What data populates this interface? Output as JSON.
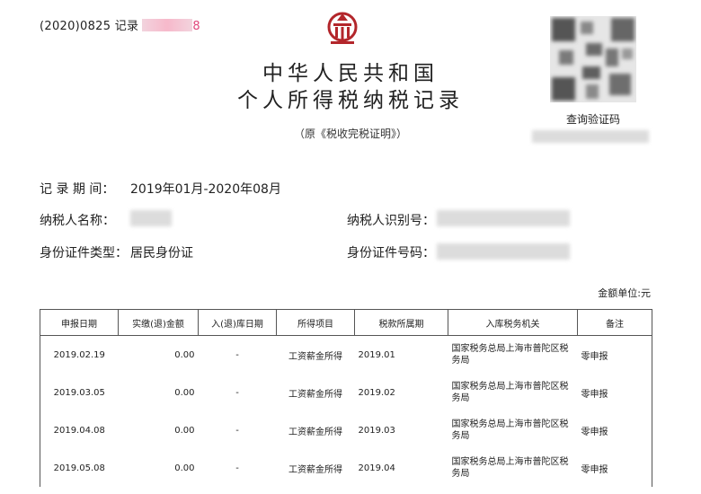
{
  "header": {
    "record_prefix": "(2020)0825  记录",
    "record_suffix": "8",
    "title_line1": "中华人民共和国",
    "title_line2": "个人所得税纳税记录",
    "subtitle": "（原《税收完税证明》）",
    "qr_label": "查询验证码"
  },
  "info": {
    "period_label": "记 录 期 间：",
    "period_value": "2019年01月-2020年08月",
    "name_label": "纳税人名称：",
    "taxid_label": "纳税人识别号：",
    "idtype_label": "身份证件类型：",
    "idtype_value": "居民身份证",
    "idno_label": "身份证件号码："
  },
  "table": {
    "unit": "金额单位:元",
    "headers": [
      "申报日期",
      "实缴(退)金额",
      "入(退)库日期",
      "所得项目",
      "税款所属期",
      "入库税务机关",
      "备注"
    ],
    "rows": [
      {
        "date": "2019.02.19",
        "amount": "0.00",
        "in_date": "-",
        "item": "工资薪金所得",
        "period": "2019.01",
        "authority": "国家税务总局上海市普陀区税务局",
        "note": "零申报"
      },
      {
        "date": "2019.03.05",
        "amount": "0.00",
        "in_date": "-",
        "item": "工资薪金所得",
        "period": "2019.02",
        "authority": "国家税务总局上海市普陀区税务局",
        "note": "零申报"
      },
      {
        "date": "2019.04.08",
        "amount": "0.00",
        "in_date": "-",
        "item": "工资薪金所得",
        "period": "2019.03",
        "authority": "国家税务总局上海市普陀区税务局",
        "note": "零申报"
      },
      {
        "date": "2019.05.08",
        "amount": "0.00",
        "in_date": "-",
        "item": "工资薪金所得",
        "period": "2019.04",
        "authority": "国家税务总局上海市普陀区税务局",
        "note": "零申报"
      }
    ]
  }
}
